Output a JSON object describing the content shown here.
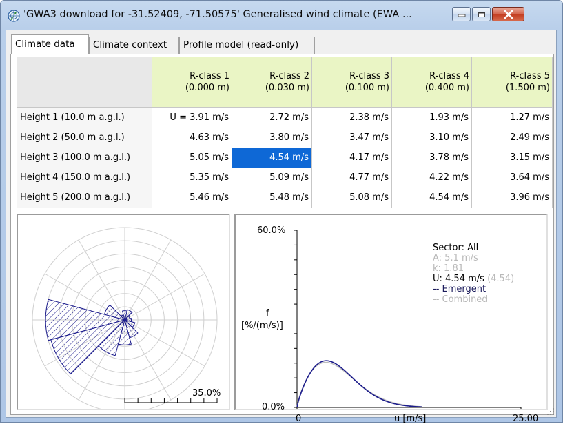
{
  "window": {
    "title": "'GWA3 download for -31.52409, -71.50575' Generalised wind climate (EWA ...",
    "buttons": {
      "minimize": "minimize-icon",
      "maximize": "maximize-icon",
      "close": "close-icon"
    }
  },
  "tabs": [
    {
      "label": "Climate data",
      "active": true
    },
    {
      "label": "Climate context",
      "active": false
    },
    {
      "label": "Profile model (read-only)",
      "active": false
    }
  ],
  "grid": {
    "columns": [
      {
        "name": "R-class 1",
        "roughness": "(0.000 m)"
      },
      {
        "name": "R-class 2",
        "roughness": "(0.030 m)"
      },
      {
        "name": "R-class 3",
        "roughness": "(0.100 m)"
      },
      {
        "name": "R-class 4",
        "roughness": "(0.400 m)"
      },
      {
        "name": "R-class 5",
        "roughness": "(1.500 m)"
      }
    ],
    "rows": [
      {
        "label": "Height 1  (10.0 m a.g.l.)",
        "values": [
          "U = 3.91 m/s",
          "2.72 m/s",
          "2.38 m/s",
          "1.93 m/s",
          "1.27 m/s"
        ]
      },
      {
        "label": "Height 2  (50.0 m a.g.l.)",
        "values": [
          "4.63 m/s",
          "3.80 m/s",
          "3.47 m/s",
          "3.10 m/s",
          "2.49 m/s"
        ]
      },
      {
        "label": "Height 3  (100.0 m a.g.l.)",
        "values": [
          "5.05 m/s",
          "4.54 m/s",
          "4.17 m/s",
          "3.78 m/s",
          "3.15 m/s"
        ]
      },
      {
        "label": "Height 4  (150.0 m a.g.l.)",
        "values": [
          "5.35 m/s",
          "5.09 m/s",
          "4.77 m/s",
          "4.22 m/s",
          "3.64 m/s"
        ]
      },
      {
        "label": "Height 5  (200.0 m a.g.l.)",
        "values": [
          "5.46 m/s",
          "5.48 m/s",
          "5.08 m/s",
          "4.54 m/s",
          "3.96 m/s"
        ]
      }
    ],
    "selected": {
      "row": 2,
      "col": 1
    }
  },
  "rose": {
    "scale_label": "35.0%",
    "max_percent": 35.0,
    "sectors_percent": [
      3.5,
      4.0,
      2.0,
      2.5,
      4.0,
      7.0,
      9.5,
      14.0,
      29.0,
      30.0,
      8.0,
      2.0
    ]
  },
  "histogram": {
    "ymax_label": "60.0%",
    "ymin_label": "0.0%",
    "xmin_label": "0",
    "xmax_label": "25.00",
    "xlabel": "u [m/s]",
    "ylabel_1": "f",
    "ylabel_2": "[%/(m/s)]",
    "legend": {
      "sector": "Sector: All",
      "a": "A: 5.1 m/s",
      "k": "k: 1.81",
      "u": "U: 4.54 m/s",
      "u_combined": "(4.54)",
      "emergent": "-- Emergent",
      "combined": "-- Combined"
    },
    "weibull": {
      "A": 5.1,
      "k": 1.81,
      "xmax": 25.0,
      "ymax_percent": 60.0
    },
    "colors": {
      "emergent": "#1c1c8c",
      "combined": "#bdbdbd"
    }
  }
}
